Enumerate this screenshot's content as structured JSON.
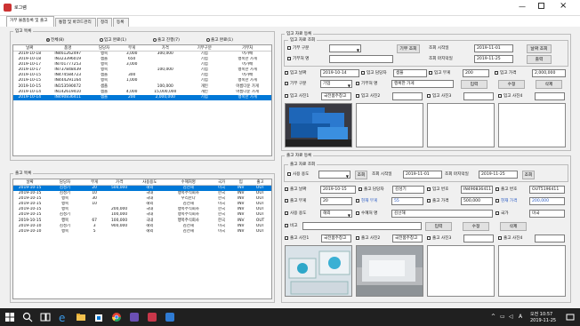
{
  "window": {
    "title": "로그램"
  },
  "tabs": [
    "거부 물품등록 및 출고",
    "통합 및 바코드관리",
    "정리",
    "등록"
  ],
  "ingoing": {
    "legend": "입고 목록",
    "filters": [
      "전체(8)",
      "입고 완료(1)",
      "출고 진행(7)",
      "출고 완료(1)"
    ],
    "columns": [
      "날짜",
      "품명",
      "담당자",
      "무게",
      "가격",
      "기부구분",
      "기부처"
    ],
    "rows": [
      [
        "2019-10-18",
        "IN461262497",
        "행복",
        "3,000",
        "300,000",
        "기업",
        "어가배"
      ],
      [
        "2019-10-18",
        "IN323396019",
        "샘플",
        "650",
        "",
        "기업",
        "행복한 가게"
      ],
      [
        "2019-10-17",
        "IN701777253",
        "행복",
        "3,000",
        "",
        "기업",
        "어가배"
      ],
      [
        "2019-10-17",
        "IN737848439",
        "행복",
        "",
        "100,000",
        "기업",
        "행복한 가게"
      ],
      [
        "2019-10-15",
        "IN474584723",
        "샘플",
        "300",
        "",
        "기업",
        "어가배"
      ],
      [
        "2019-10-15",
        "IN444291164",
        "행복",
        "1,000",
        "",
        "기업",
        "행복한 가게"
      ],
      [
        "2019-10-15",
        "IN153590072",
        "샘플",
        "",
        "100,000",
        "개인",
        "아름다운 가게"
      ],
      [
        "2019-10-14",
        "IN142619410",
        "샘플",
        "4,000",
        "15,000,000",
        "개인",
        "아름다운 가게"
      ],
      [
        "2019-10-14",
        "IN490836411",
        "샘플",
        "200",
        "2,000,000",
        "기업",
        "행복한 가게"
      ]
    ]
  },
  "outgoing": {
    "legend": "출고 목록",
    "columns": [
      "날짜",
      "담당자",
      "무게",
      "가격",
      "사용용도",
      "수혜처명",
      "국가",
      "입",
      "출고"
    ],
    "rows": [
      [
        "2019-10-15",
        "김성기",
        "20",
        "500,000",
        "해외",
        "김선해",
        "미국",
        "INV",
        "OUT"
      ],
      [
        "2019-10-15",
        "김성기",
        "10",
        "",
        "국내",
        "행복주식회사",
        "한국",
        "INV",
        "OUT"
      ],
      [
        "2019-10-15",
        "행복",
        "30",
        "",
        "국내",
        "우리한다",
        "한국",
        "INV",
        "OUT"
      ],
      [
        "2019-10-15",
        "행복",
        "10",
        "",
        "해외",
        "김선해",
        "미국",
        "INV",
        "OUT"
      ],
      [
        "2019-10-15",
        "행복",
        "",
        "200,000",
        "국내",
        "행복주식회사",
        "한국",
        "INV",
        "OUT"
      ],
      [
        "2019-10-15",
        "김성기",
        "",
        "100,000",
        "국내",
        "행복주식회사",
        "한국",
        "INV",
        "OUT"
      ],
      [
        "2019-10-15",
        "행복",
        "67",
        "100,000",
        "국내",
        "행복주식회사",
        "한국",
        "INV",
        "OUT"
      ],
      [
        "2019-10-10",
        "김성기",
        "3",
        "900,000",
        "해외",
        "김선해",
        "미국",
        "INV",
        "OUT"
      ],
      [
        "2019-10-10",
        "행복",
        "5",
        "",
        "해외",
        "김선해",
        "미국",
        "INV",
        "OUT"
      ]
    ]
  },
  "in_register": {
    "legend": "입고 자료 등록",
    "search_legend": "입고 자료 조회",
    "donor_type_label": "기부 구분",
    "donor_name_label": "기부처 명",
    "donor_search_btn": "기부 조회",
    "start_label": "조회 시작일",
    "start_value": "2019-11-01",
    "end_label": "조회 마지막일",
    "end_value": "2019-11-25",
    "date_search_btn": "날짜 조회",
    "print_btn": "출력",
    "date_label": "입고 날짜",
    "date_value": "2019-10-14",
    "manager_label": "입고 담당자",
    "manager_value": "샘플",
    "weight_label": "입고 무게",
    "weight_value": "200",
    "price_label": "입고 가격",
    "price_value": "2,000,000",
    "type_label": "기부 구분",
    "type_value": "기업",
    "donor_label": "기부처 명",
    "donor_value": "행복한 가게",
    "in_btn": "입력",
    "edit_btn": "수정",
    "del_btn": "삭제",
    "photo1_label": "입고 사진1",
    "photo1_value": "국전품주창고",
    "photo2_label": "입고 사진2",
    "photo3_label": "입고 사진3",
    "photo4_label": "입고 사진4"
  },
  "out_register": {
    "legend": "출고 자료 등록",
    "search_legend": "출고 자료 조회",
    "use_label": "사용 용도",
    "search_btn": "조회",
    "start_label": "조회 시작일",
    "start_value": "2019-11-01",
    "end_label": "조회 마지막일",
    "end_value": "2019-11-25",
    "search_btn2": "조회",
    "date_label": "출고 날짜",
    "date_value": "2019-10-15",
    "manager_label": "출고 담당자",
    "manager_value": "김성기",
    "inno_label": "입고 번호",
    "inno_value": "IN490836411",
    "outno_label": "출고 번호",
    "outno_value": "OUT5196411",
    "weight_label": "출고 무게",
    "weight_value": "20",
    "cur_weight_label": "현재 무게",
    "cur_weight_value": "55",
    "price_label": "출고 가격",
    "price_value": "500,000",
    "cur_price_label": "현재 가격",
    "cur_price_value": "200,000",
    "use2_label": "사용 용도",
    "use2_value": "해외",
    "benef_label": "수혜처 명",
    "benef_value": "김선해",
    "country_label": "국가",
    "country_value": "미국",
    "note_label": "비고",
    "in_btn": "입력",
    "edit_btn": "수정",
    "del_btn": "삭제",
    "photo1_label": "출고 사진1",
    "photo1_value": "국전품주창고",
    "photo2_label": "출고 사진2",
    "photo2_value": "국전품주창고",
    "photo3_label": "출고 사진3",
    "photo4_label": "출고 사진4"
  },
  "taskbar": {
    "ampm": "오전",
    "time": "10:57",
    "date": "2019-11-25",
    "lang": "A"
  },
  "colors": {
    "selection": "#0078d7",
    "taskbar": "#202020"
  }
}
